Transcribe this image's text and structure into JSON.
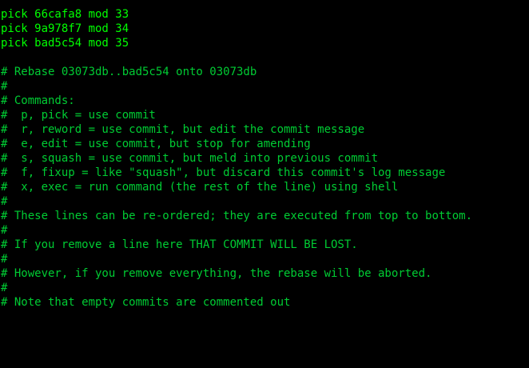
{
  "editor": {
    "lines": [
      "pick 66cafa8 mod 33",
      "pick 9a978f7 mod 34",
      "pick bad5c54 mod 35",
      "",
      "# Rebase 03073db..bad5c54 onto 03073db",
      "#",
      "# Commands:",
      "#  p, pick = use commit",
      "#  r, reword = use commit, but edit the commit message",
      "#  e, edit = use commit, but stop for amending",
      "#  s, squash = use commit, but meld into previous commit",
      "#  f, fixup = like \"squash\", but discard this commit's log message",
      "#  x, exec = run command (the rest of the line) using shell",
      "#",
      "# These lines can be re-ordered; they are executed from top to bottom.",
      "#",
      "# If you remove a line here THAT COMMIT WILL BE LOST.",
      "#",
      "# However, if you remove everything, the rebase will be aborted.",
      "#",
      "# Note that empty commits are commented out"
    ]
  },
  "colors": {
    "background": "#000000",
    "text": "#00ff00"
  }
}
